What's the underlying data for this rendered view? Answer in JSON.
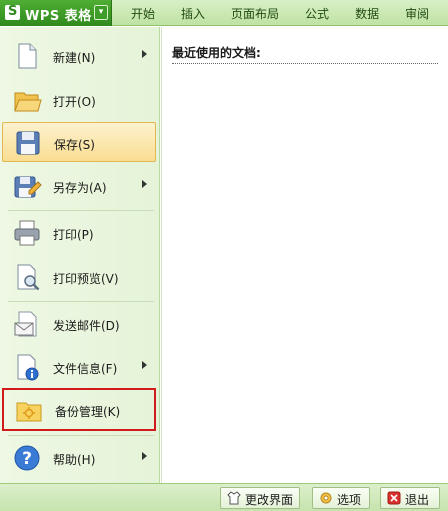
{
  "app": {
    "title": "WPS 表格",
    "dropdown_glyph": "▾"
  },
  "tabs": [
    "开始",
    "插入",
    "页面布局",
    "公式",
    "数据",
    "审阅"
  ],
  "menu": {
    "items": [
      {
        "label": "新建(N)",
        "icon": "new-document-icon",
        "submenu": true
      },
      {
        "label": "打开(O)",
        "icon": "open-folder-icon",
        "submenu": false
      },
      {
        "label": "保存(S)",
        "icon": "save-disk-icon",
        "submenu": false,
        "active": true
      },
      {
        "label": "另存为(A)",
        "icon": "save-as-icon",
        "submenu": true
      },
      {
        "label": "打印(P)",
        "icon": "printer-icon",
        "submenu": false
      },
      {
        "label": "打印预览(V)",
        "icon": "print-preview-icon",
        "submenu": false
      },
      {
        "label": "发送邮件(D)",
        "icon": "mail-icon",
        "submenu": false
      },
      {
        "label": "文件信息(F)",
        "icon": "file-info-icon",
        "submenu": true
      },
      {
        "label": "备份管理(K)",
        "icon": "backup-folder-icon",
        "submenu": false,
        "highlighted": true
      },
      {
        "label": "帮助(H)",
        "icon": "help-icon",
        "submenu": true
      }
    ]
  },
  "recent": {
    "title": "最近使用的文档:"
  },
  "bottom": {
    "change_ui": "更改界面",
    "options": "选项",
    "exit": "退出"
  },
  "colors": {
    "accent": "#2f8a1c",
    "menu_bg": "#eef8e4",
    "highlight_border": "#d11a1a",
    "active_bg": "#f9dd92"
  }
}
